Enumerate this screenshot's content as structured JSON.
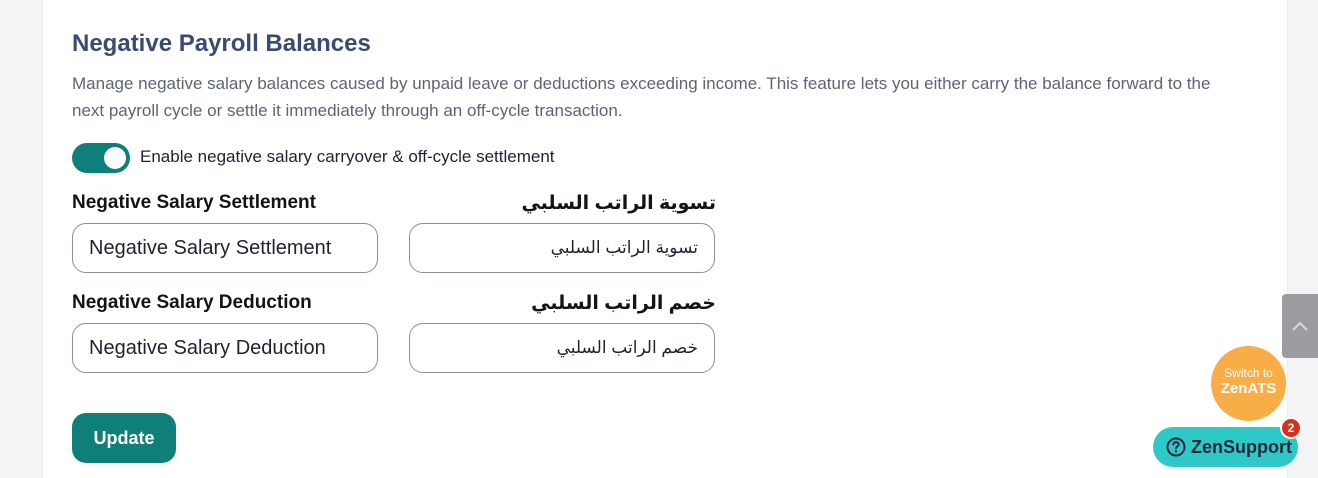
{
  "section": {
    "title": "Negative Payroll Balances",
    "description": "Manage negative salary balances caused by unpaid leave or deductions exceeding income. This feature lets you either carry the balance forward to the next payroll cycle or settle it immediately through an off-cycle transaction."
  },
  "toggle": {
    "label": "Enable negative salary carryover & off-cycle settlement",
    "enabled": true
  },
  "fields": {
    "settlement": {
      "label_en": "Negative Salary Settlement",
      "label_ar": "تسوية الراتب السلبي",
      "value_en": "Negative Salary Settlement",
      "value_ar": "تسوية الراتب السلبي"
    },
    "deduction": {
      "label_en": "Negative Salary Deduction",
      "label_ar": "خصم الراتب السلبي",
      "value_en": "Negative Salary Deduction",
      "value_ar": "خصم الراتب السلبي"
    }
  },
  "actions": {
    "update_label": "Update"
  },
  "floating": {
    "switch_small": "Switch to",
    "switch_big": "ZenATS",
    "support_label": "ZenSupport",
    "support_badge": "2"
  },
  "colors": {
    "accent": "#0f7f7a",
    "title": "#3b4a72",
    "switch_bg": "#f9ad47",
    "support_bg": "#2ec9c6",
    "badge_bg": "#d9301c"
  },
  "icons": {
    "scroll_top": "chevron-up-icon",
    "support": "question-circle-icon"
  }
}
